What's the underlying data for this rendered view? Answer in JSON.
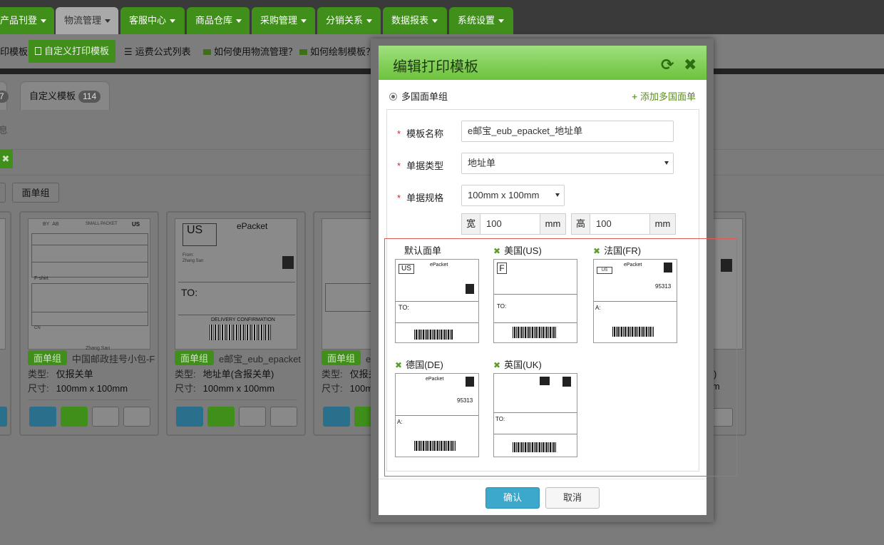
{
  "nav": {
    "tabs": [
      {
        "label": "产品刊登"
      },
      {
        "label": "物流管理"
      },
      {
        "label": "客服中心"
      },
      {
        "label": "商品仓库"
      },
      {
        "label": "采购管理"
      },
      {
        "label": "分销关系"
      },
      {
        "label": "数据报表"
      },
      {
        "label": "系统设置"
      }
    ]
  },
  "subnav": {
    "partial_left": "印模板",
    "custom_print_template": "自定义打印模板",
    "freight_formula_list": "运费公式列表",
    "help_logistics": "如何使用物流管理？",
    "help_draw_template": "如何绘制模板？"
  },
  "background": {
    "tab_partial_count": "7",
    "tab_custom_label": "自定义模板",
    "tab_custom_count": "114",
    "partial_info": "息",
    "face_group_btn": "面单组",
    "cards": [
      {
        "tag": "面单组",
        "name": "中国邮政挂号小包-F",
        "type_label": "类型:",
        "type": "仅报关单",
        "size_label": "尺寸:",
        "size": "100mm x 100mm"
      },
      {
        "tag": "面单组",
        "name": "e邮宝_eub_epacket",
        "type_label": "类型:",
        "type": "地址单(含报关单)",
        "size_label": "尺寸:",
        "size": "100mm x 100mm"
      },
      {
        "tag": "面单组",
        "name": "e邮",
        "type_label": "类型:",
        "type": "仅报关",
        "size_label": "尺寸:",
        "size": "100mm"
      }
    ],
    "right_partial_type": "单)",
    "right_partial_size": "mm"
  },
  "modal": {
    "title": "编辑打印模板",
    "group_radio_label": "多国面单组",
    "add_link": "添加多国面单",
    "template_name_label": "模板名称",
    "template_name_value": "e邮宝_eub_epacket_地址单",
    "doc_type_label": "单据类型",
    "doc_type_value": "地址单",
    "doc_spec_label": "单据规格",
    "doc_spec_value": "100mm x 100mm",
    "width_label": "宽",
    "width_value": "100",
    "width_unit": "mm",
    "height_label": "高",
    "height_value": "100",
    "height_unit": "mm",
    "templates": [
      {
        "name": "默认面单",
        "removable": false
      },
      {
        "name": "美国(US)",
        "removable": true
      },
      {
        "name": "法国(FR)",
        "removable": true
      },
      {
        "name": "德国(DE)",
        "removable": true
      },
      {
        "name": "英国(UK)",
        "removable": true
      }
    ],
    "confirm": "确认",
    "cancel": "取消"
  },
  "colors": {
    "nav_green": "#3f8f1a",
    "modal_header_green": "#7fce52",
    "confirm_blue": "#3ba8cc",
    "highlight_red": "#e05a5a"
  }
}
